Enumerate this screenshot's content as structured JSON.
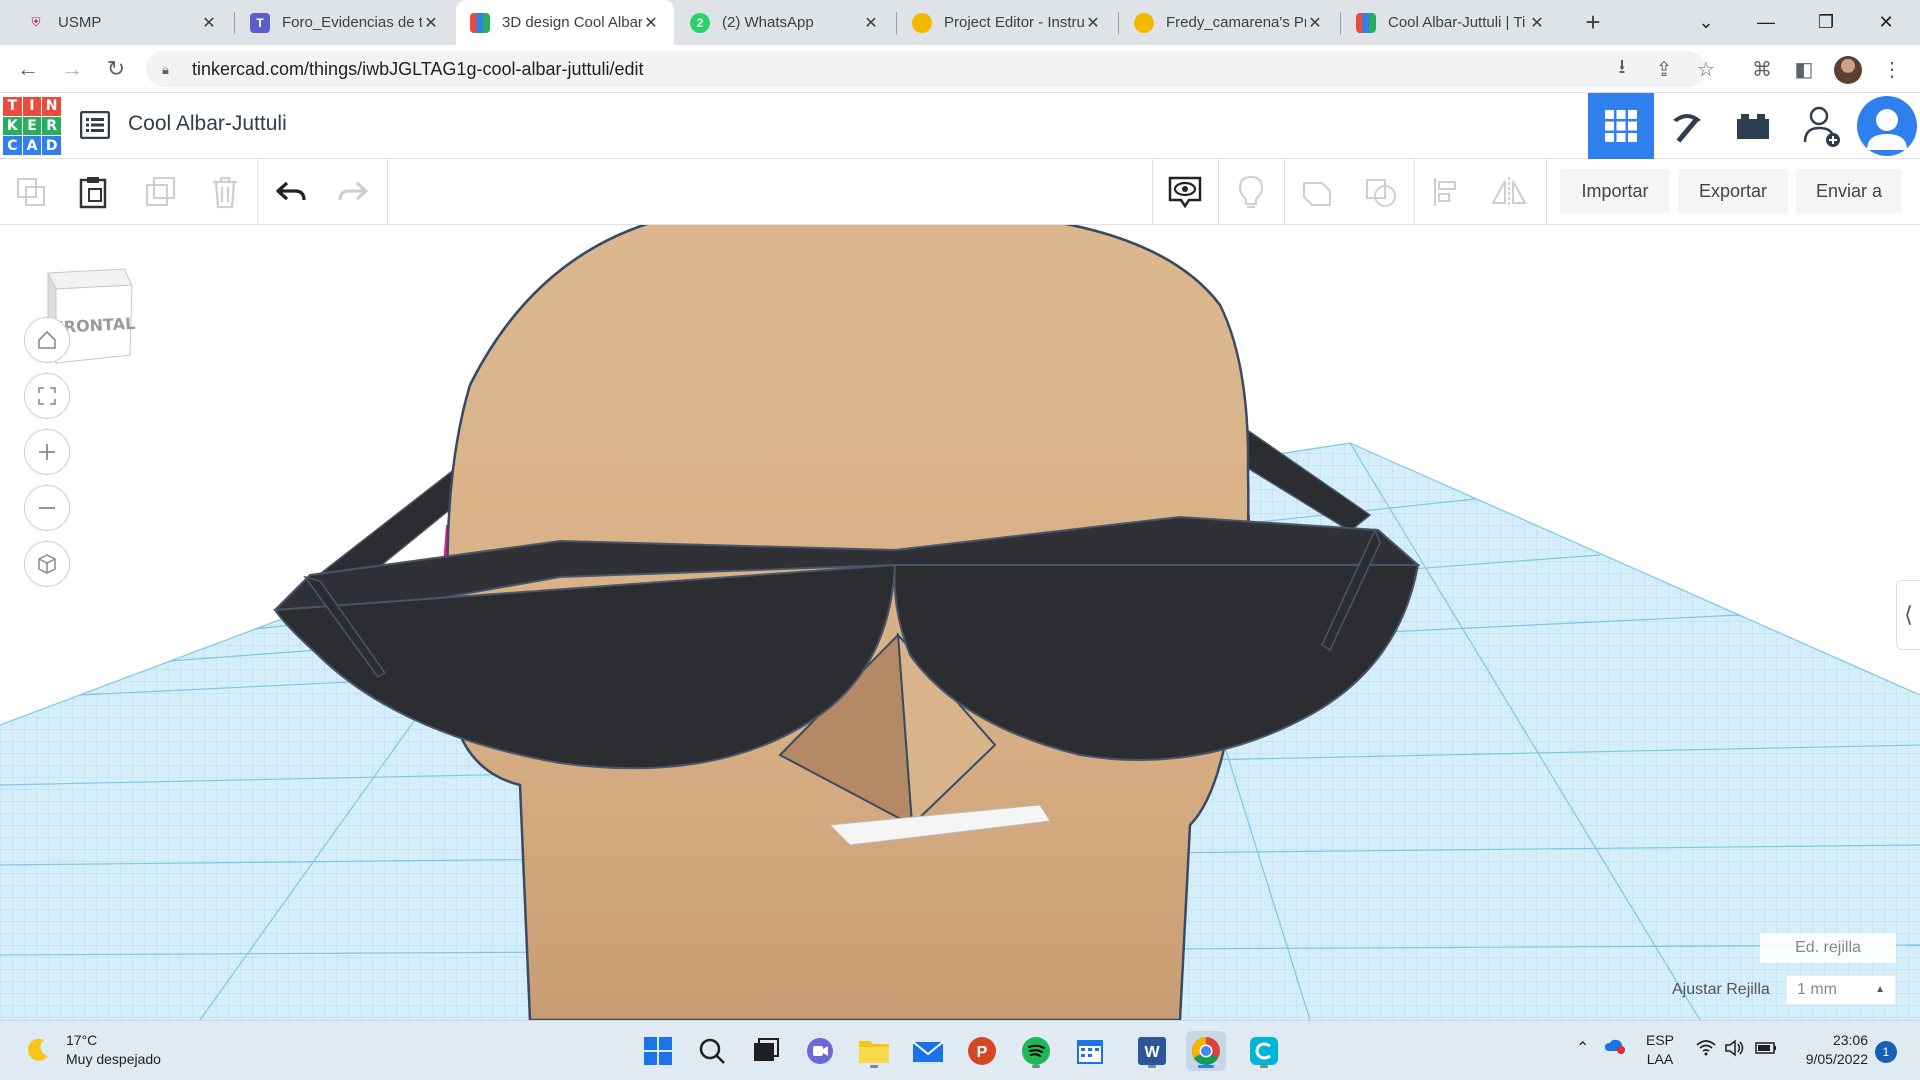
{
  "browser": {
    "tabs": [
      {
        "label": "USMP",
        "favicon": "usmp-shield-icon"
      },
      {
        "label": "Foro_Evidencias de tr",
        "favicon": "teams-icon"
      },
      {
        "label": "3D design Cool Albar",
        "favicon": "tinkercad-icon"
      },
      {
        "label": "(2) WhatsApp",
        "favicon": "whatsapp-icon",
        "badge": "2"
      },
      {
        "label": "Project Editor - Instru",
        "favicon": "instructables-icon"
      },
      {
        "label": "Fredy_camarena's Pr",
        "favicon": "instructables-icon"
      },
      {
        "label": "Cool Albar-Juttuli | Ti",
        "favicon": "tinkercad-icon"
      }
    ],
    "active_tab": 2,
    "url": "tinkercad.com/things/iwbJGLTAG1g-cool-albar-juttuli/edit"
  },
  "tinkercad": {
    "logo_letters": [
      "T",
      "I",
      "N",
      "K",
      "E",
      "R",
      "C",
      "A",
      "D"
    ],
    "design_title": "Cool Albar-Juttuli",
    "toolbar": {
      "import_label": "Importar",
      "export_label": "Exportar",
      "send_label": "Enviar a"
    },
    "viewcube_label": "FRONTAL",
    "grid_edit_label": "Ed. rejilla",
    "snap_grid_label": "Ajustar Rejilla",
    "snap_grid_value": "1 mm"
  },
  "taskbar": {
    "weather_temp": "17°C",
    "weather_desc": "Muy despejado",
    "lang_top": "ESP",
    "lang_bottom": "LAA",
    "time": "23:06",
    "date": "9/05/2022",
    "notification_count": "1"
  },
  "colors": {
    "accent": "#2f80ed",
    "head": "#d9b48a",
    "glasses": "#2b2d31",
    "grid_line": "#7fc6e8",
    "grid_fill": "#d5eef9"
  }
}
